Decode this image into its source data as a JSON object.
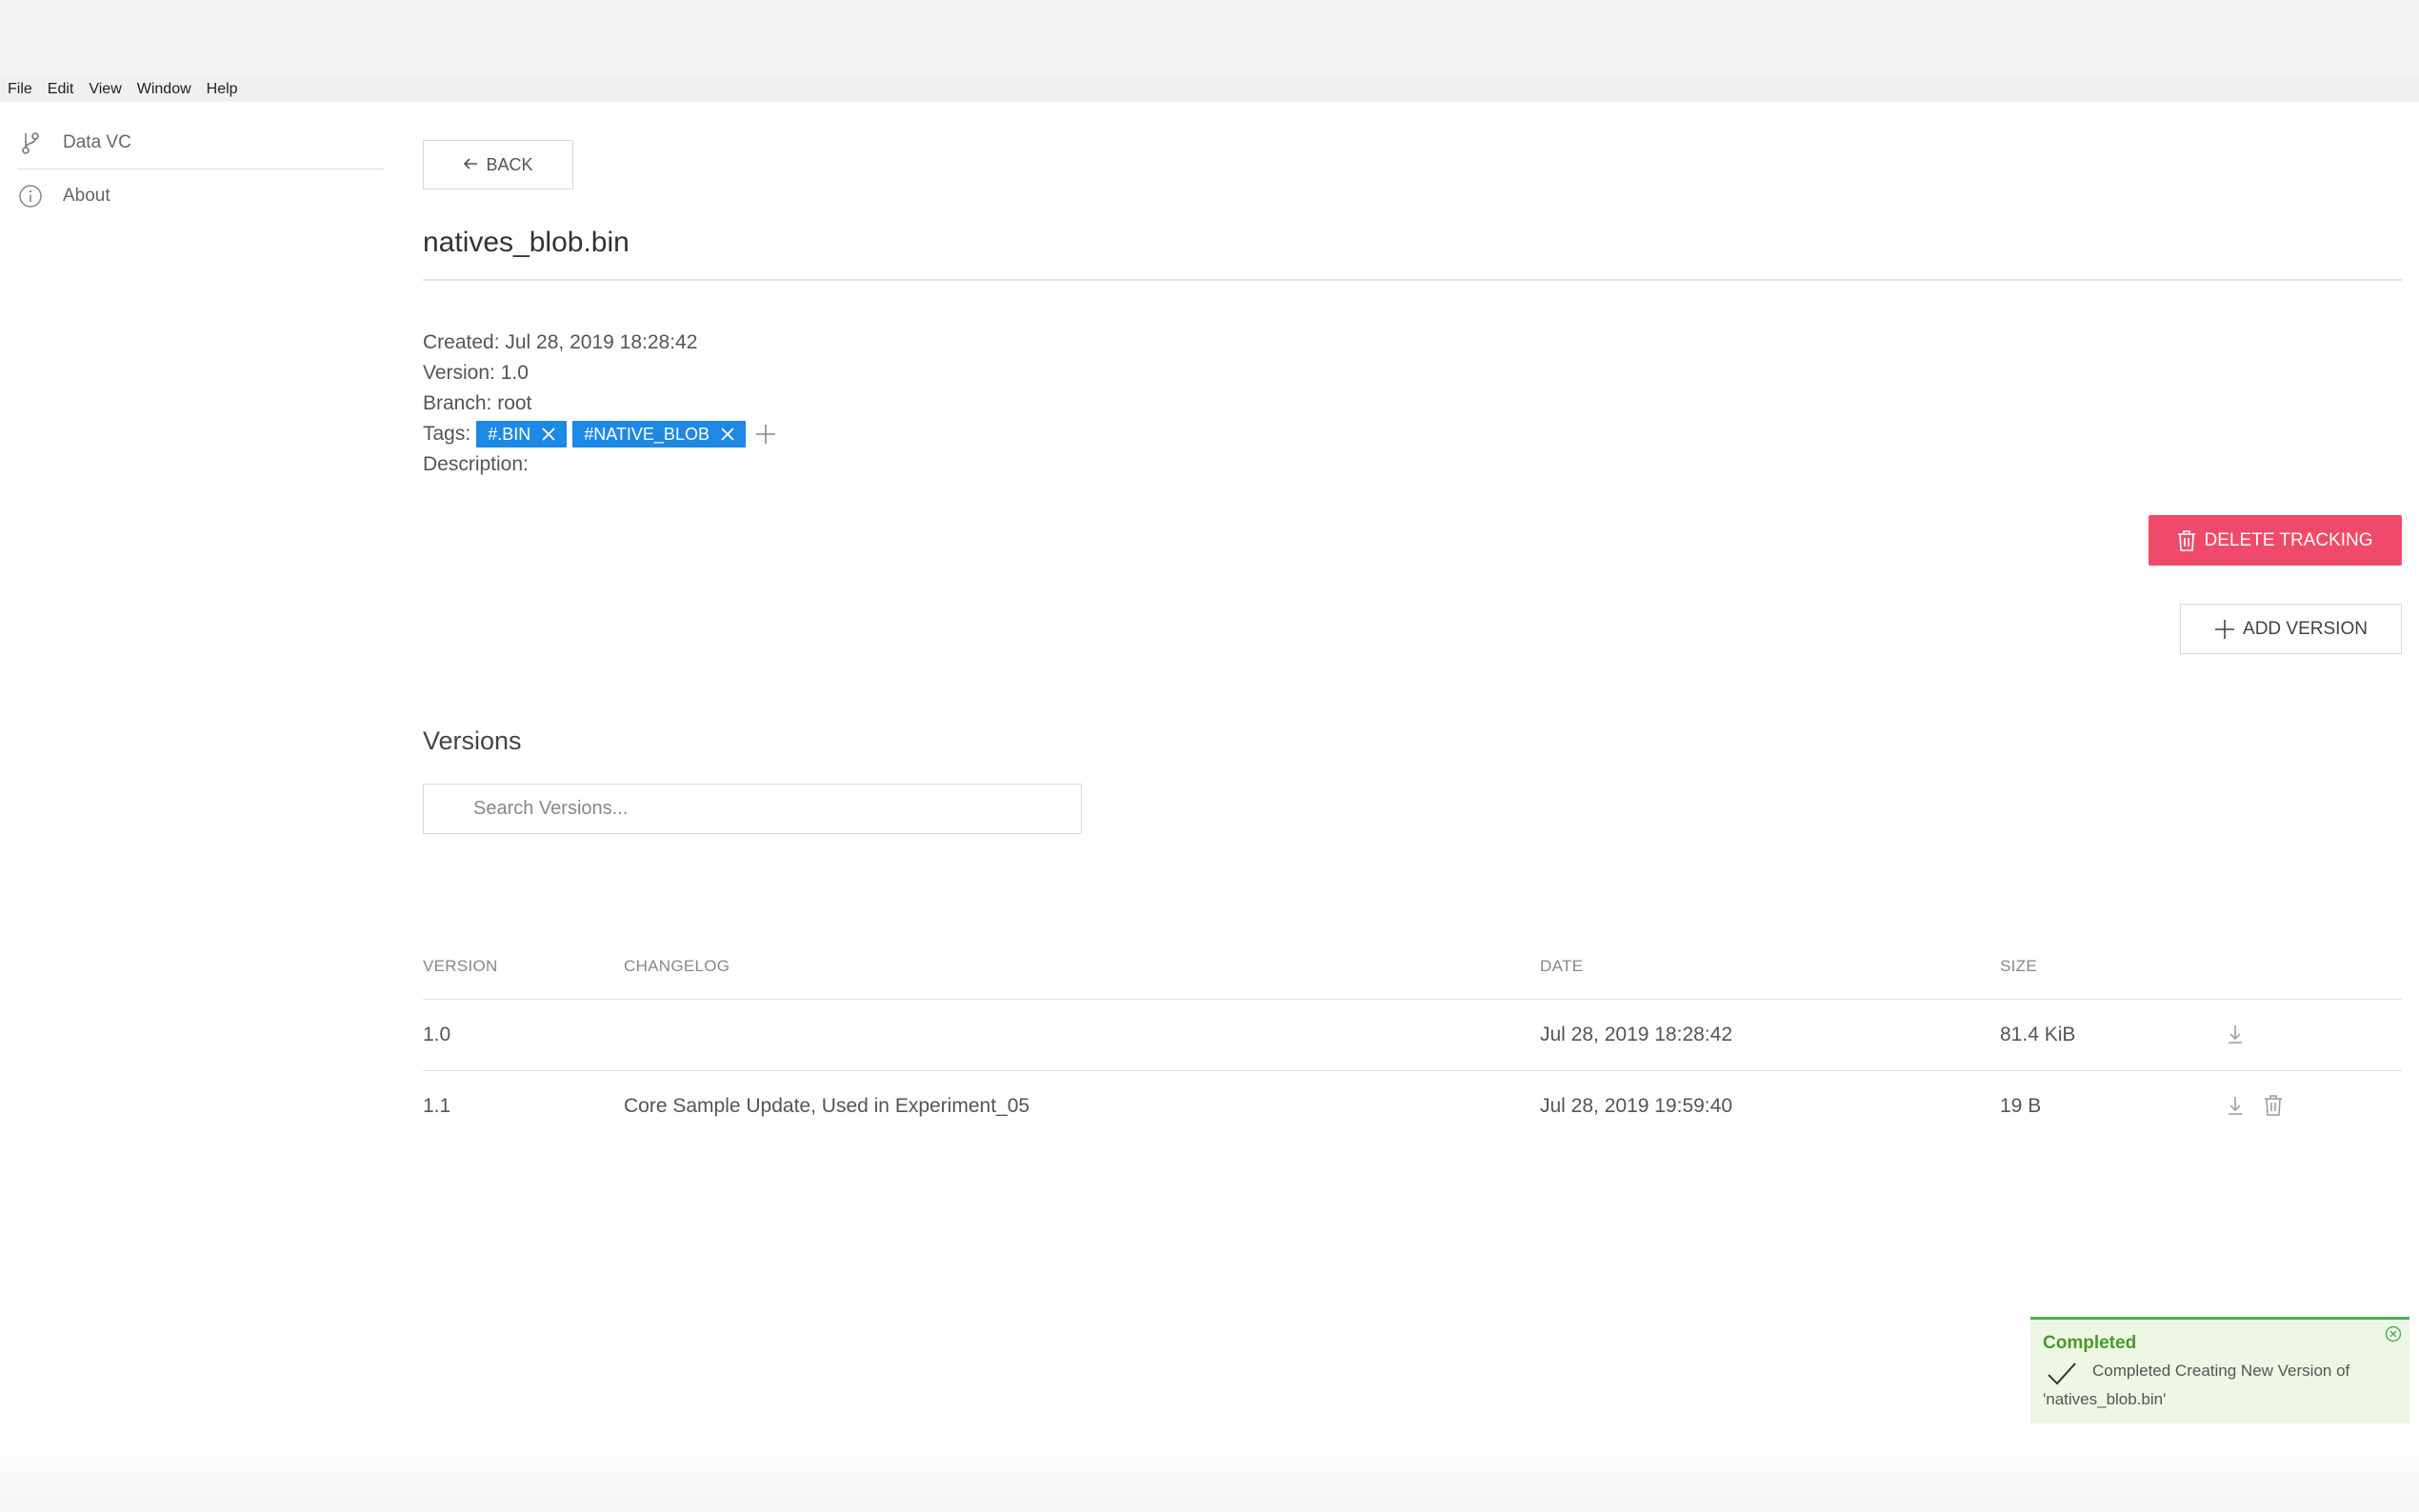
{
  "menu": [
    "File",
    "Edit",
    "View",
    "Window",
    "Help"
  ],
  "sidebar": {
    "items": [
      {
        "label": "Data VC",
        "icon": "branch-icon"
      },
      {
        "label": "About",
        "icon": "info-icon"
      }
    ]
  },
  "toolbar": {
    "back_label": "BACK"
  },
  "file": {
    "title": "natives_blob.bin",
    "created": "Created: Jul 28, 2019 18:28:42",
    "version": "Version: 1.0",
    "branch": "Branch: root",
    "tags_label": "Tags:",
    "tags": [
      "#.BIN",
      "#NATIVE_BLOB"
    ],
    "description_label": "Description:"
  },
  "actions": {
    "delete_label": "DELETE TRACKING",
    "add_label": "ADD VERSION",
    "delete_color": "#f04a6b"
  },
  "versions": {
    "title": "Versions",
    "search_placeholder": "Search Versions...",
    "columns": [
      "VERSION",
      "CHANGELOG",
      "DATE",
      "SIZE"
    ],
    "rows": [
      {
        "version": "1.0",
        "changelog": "",
        "date": "Jul 28, 2019 18:28:42",
        "size": "81.4 KiB"
      },
      {
        "version": "1.1",
        "changelog": "Core Sample Update, Used in Experiment_05",
        "date": "Jul 28, 2019 19:59:40",
        "size": "19 B"
      }
    ]
  },
  "toast": {
    "title": "Completed",
    "message": "Completed Creating New Version of",
    "message2": "'natives_blob.bin'",
    "color": "#4caf50"
  }
}
